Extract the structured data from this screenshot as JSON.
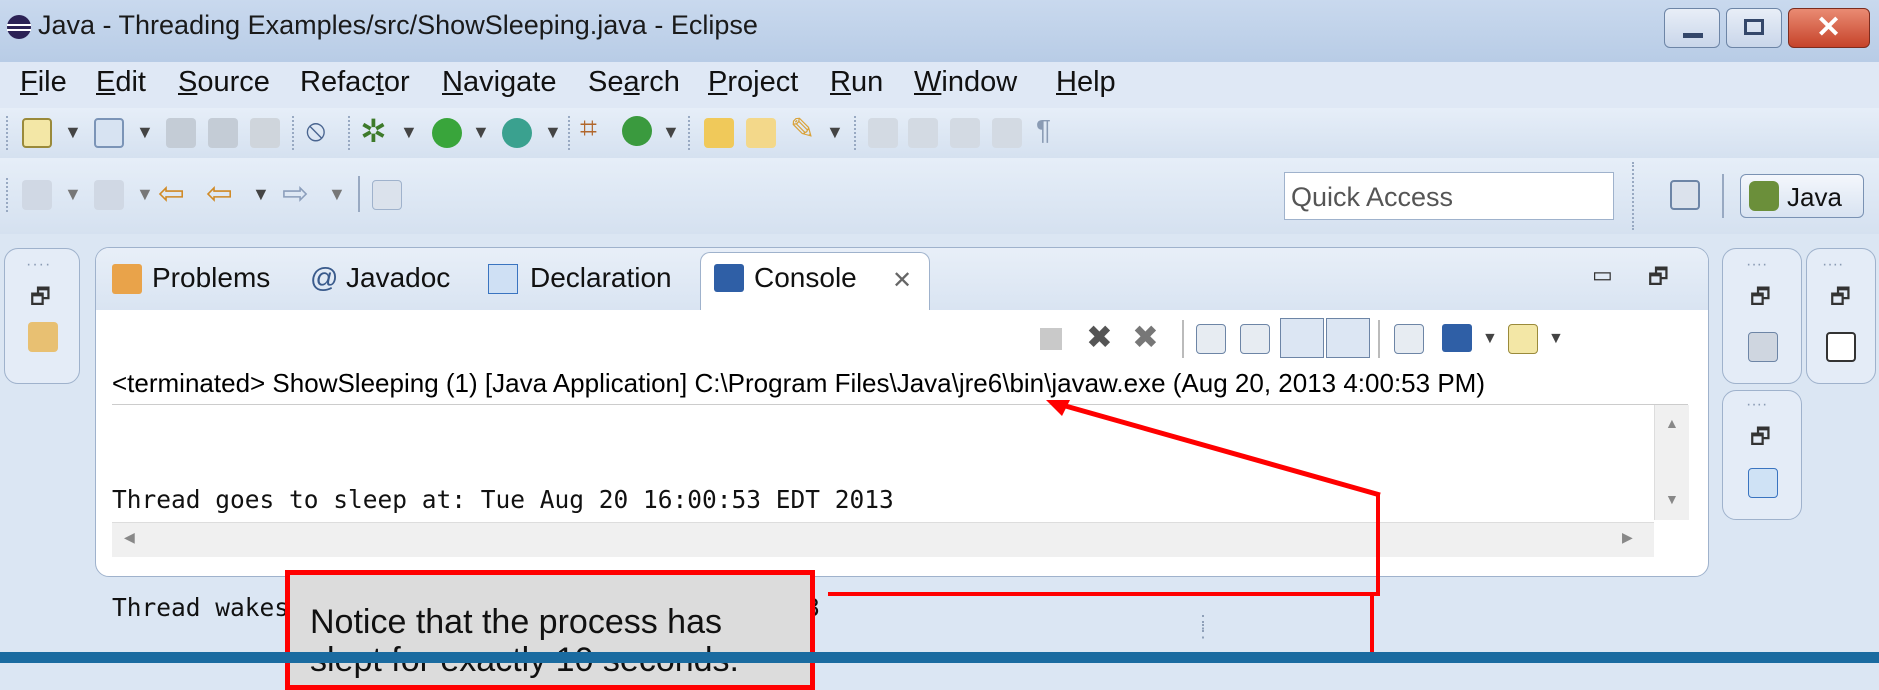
{
  "window": {
    "title": "Java - Threading Examples/src/ShowSleeping.java - Eclipse"
  },
  "menu": [
    {
      "pre": "",
      "u": "F",
      "post": "ile"
    },
    {
      "pre": "",
      "u": "E",
      "post": "dit"
    },
    {
      "pre": "",
      "u": "S",
      "post": "ource"
    },
    {
      "pre": "Refac",
      "u": "t",
      "post": "or"
    },
    {
      "pre": "",
      "u": "N",
      "post": "avigate"
    },
    {
      "pre": "Se",
      "u": "a",
      "post": "rch"
    },
    {
      "pre": "",
      "u": "P",
      "post": "roject"
    },
    {
      "pre": "",
      "u": "R",
      "post": "un"
    },
    {
      "pre": "",
      "u": "W",
      "post": "indow"
    },
    {
      "pre": "",
      "u": "H",
      "post": "elp"
    }
  ],
  "quick_access": {
    "placeholder": "Quick Access"
  },
  "perspective": {
    "label": "Java"
  },
  "tabs": {
    "problems": "Problems",
    "javadoc": "Javadoc",
    "declaration": "Declaration",
    "console": "Console"
  },
  "console": {
    "terminated_line": "<terminated> ShowSleeping (1) [Java Application] C:\\Program Files\\Java\\jre6\\bin\\javaw.exe (Aug 20, 2013 4:00:53 PM)",
    "output_lines": [
      "Thread goes to sleep at: Tue Aug 20 16:00:53 EDT 2013",
      "Thread wakes up at: Tue Aug 20 16:01:03 EDT 2013"
    ]
  },
  "callout": {
    "line1": "Notice that the process has",
    "line2": "slept for exactly 10 seconds."
  },
  "colors": {
    "annotation_red": "#ff0000",
    "title_bar": "#c9d9ee",
    "callout_bg": "#dcdcdc"
  }
}
